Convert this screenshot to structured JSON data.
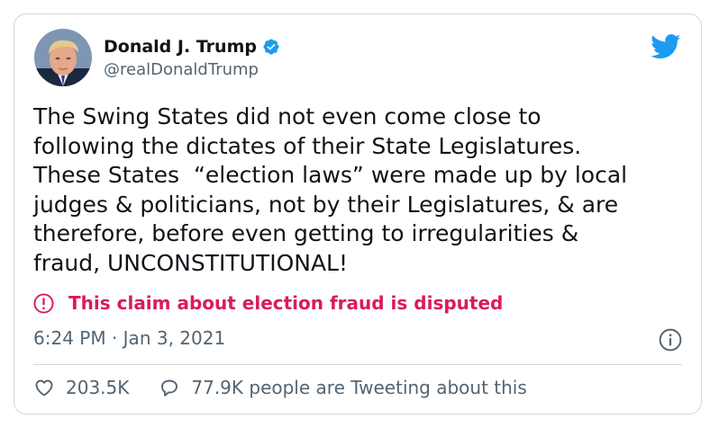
{
  "author": {
    "display_name": "Donald J. Trump",
    "handle": "@realDonaldTrump",
    "verified": true
  },
  "tweet": {
    "text": "The Swing States did not even come close to\nfollowing the dictates of their State Legislatures.\nThese States  “election laws” were made up by local\njudges & politicians, not by their Legislatures, & are\ntherefore, before even getting to irregularities &\nfraud, UNCONSTITUTIONAL!",
    "notice": "This claim about election fraud is disputed",
    "timestamp": "6:24 PM · Jan 3, 2021"
  },
  "engagement": {
    "likes": "203.5K",
    "conversation": "77.9K people are Tweeting about this"
  },
  "icons": {
    "brand": "twitter-bird-icon",
    "verified": "verified-badge-icon",
    "notice": "exclamation-circle-icon",
    "info": "info-icon",
    "like": "heart-icon",
    "reply": "speech-bubble-icon"
  },
  "colors": {
    "twitter_blue": "#1d9bf0",
    "notice_red": "#d81c5a",
    "secondary_text": "#536471",
    "primary_text": "#0f1419",
    "border": "#cfd9de"
  }
}
